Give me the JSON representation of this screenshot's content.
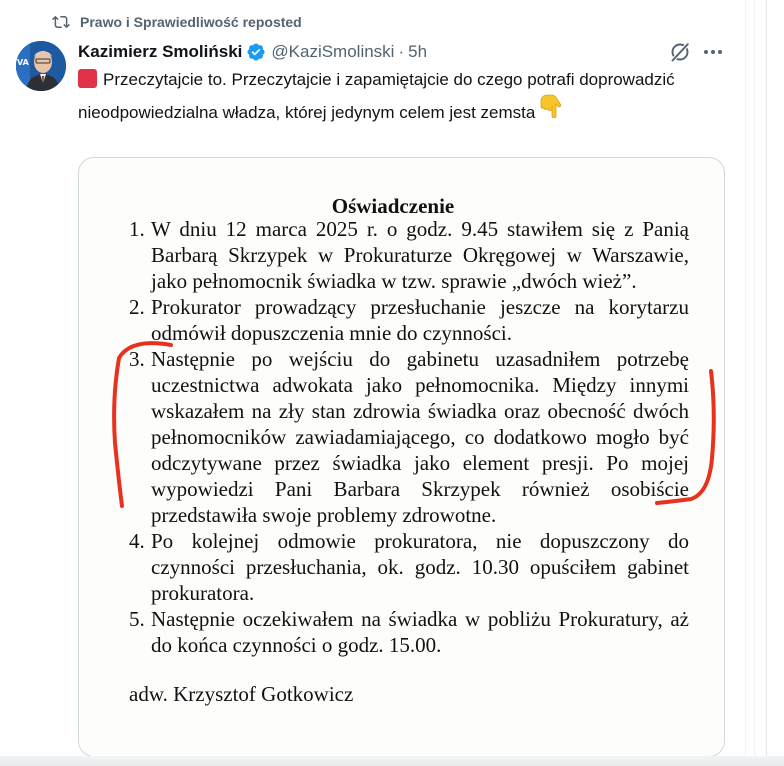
{
  "repost": {
    "icon": "repost-icon",
    "text": "Prawo i Sprawiedliwość reposted"
  },
  "author": {
    "name": "Kazimierz Smoliński",
    "handle": "@KaziSmolinski",
    "separator": "·",
    "time": "5h",
    "verified_icon": "verified-badge-icon"
  },
  "actions": {
    "grok_icon": "grok-icon",
    "more_icon": "more-icon",
    "more_label": "···"
  },
  "tweet": {
    "lead_emoji": "red-square",
    "text": "Przeczytajcie to. Przeczytajcie i zapamiętajcie do czego potrafi doprowadzić nieodpowiedzialna władza, której jedynym celem jest zemsta",
    "trailing_emoji": "👇"
  },
  "document": {
    "title": "Oświadczenie",
    "items": [
      {
        "num": "1.",
        "text": "W dniu 12 marca 2025 r. o godz. 9.45 stawiłem się z Panią Barbarą Skrzypek w Prokuraturze Okręgowej w Warszawie, jako pełnomocnik świadka w tzw. sprawie „dwóch wież”."
      },
      {
        "num": "2.",
        "text": "Prokurator prowadzący przesłuchanie jeszcze na korytarzu odmówił dopuszczenia mnie do czynności."
      },
      {
        "num": "3.",
        "text": "Następnie po wejściu do gabinetu uzasadniłem potrzebę uczestnictwa adwokata jako pełnomocnika. Między innymi wskazałem na zły stan zdrowia świadka oraz obecność dwóch pełnomocników zawiadamiającego, co dodatkowo mogło być odczytywane przez świadka jako element presji. Po mojej wypowiedzi Pani Barbara Skrzypek również osobiście przedstawiła swoje problemy zdrowotne."
      },
      {
        "num": "4.",
        "text": "Po kolejnej odmowie prokuratora, nie dopuszczony do czynności przesłuchania, ok. godz. 10.30 opuściłem gabinet prokuratora."
      },
      {
        "num": "5.",
        "text": "Następnie oczekiwałem na świadka w pobliżu Prokuratury, aż do końca czynności o godz. 15.00."
      }
    ],
    "signature": "adw. Krzysztof Gotkowicz",
    "marker_color": "#e8321e"
  },
  "colors": {
    "text_primary": "#0f1419",
    "text_secondary": "#536471",
    "verified_blue": "#1d9bf0",
    "card_border": "#cfd9de"
  }
}
